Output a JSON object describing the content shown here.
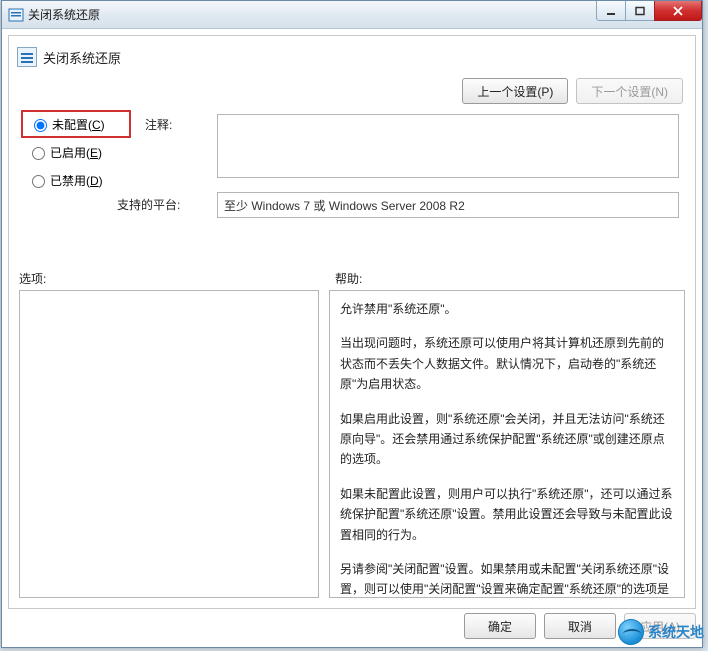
{
  "window": {
    "title": "关闭系统还原"
  },
  "header": {
    "title": "关闭系统还原"
  },
  "nav": {
    "prev": "上一个设置(P)",
    "next": "下一个设置(N)"
  },
  "radios": {
    "not_configured_pre": "未配置(",
    "not_configured_key": "C",
    "not_configured_post": ")",
    "enabled_pre": "已启用(",
    "enabled_key": "E",
    "enabled_post": ")",
    "disabled_pre": "已禁用(",
    "disabled_key": "D",
    "disabled_post": ")",
    "selected": "not_configured"
  },
  "labels": {
    "comment": "注释:",
    "platform": "支持的平台:",
    "options": "选项:",
    "help": "帮助:"
  },
  "fields": {
    "comment_value": "",
    "platform_value": "至少 Windows 7 或 Windows Server 2008 R2"
  },
  "help_paragraphs": [
    "允许禁用\"系统还原\"。",
    "当出现问题时，系统还原可以使用户将其计算机还原到先前的状态而不丢失个人数据文件。默认情况下，启动卷的\"系统还原\"为启用状态。",
    "如果启用此设置，则\"系统还原\"会关闭，并且无法访问\"系统还原向导\"。还会禁用通过系统保护配置\"系统还原\"或创建还原点的选项。",
    "如果未配置此设置，则用户可以执行\"系统还原\"，还可以通过系统保护配置\"系统还原\"设置。禁用此设置还会导致与未配置此设置相同的行为。",
    "另请参阅\"关闭配置\"设置。如果禁用或未配置\"关闭系统还原\"设置，则可以使用\"关闭配置\"设置来确定配置\"系统还原\"的选项是否可用。"
  ],
  "footer": {
    "ok": "确定",
    "cancel": "取消",
    "apply": "应用(A)"
  },
  "watermark": "系统天地"
}
